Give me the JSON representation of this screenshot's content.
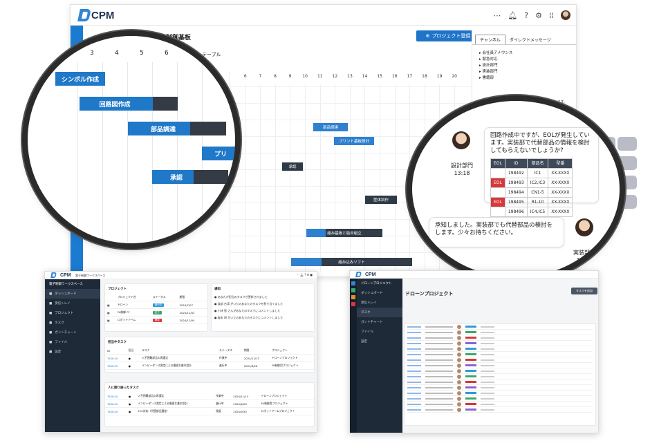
{
  "app": {
    "name": "CPM"
  },
  "main": {
    "gantt_title": "制御基板",
    "project_button": "プロジェクト登録",
    "table_label": "テーブル",
    "days": [
      "6",
      "7",
      "8",
      "9",
      "10",
      "11",
      "12",
      "13",
      "14",
      "15",
      "16",
      "17",
      "18",
      "19",
      "20"
    ],
    "bars": [
      {
        "label": "部品調達"
      },
      {
        "label": "プリント基板設計"
      },
      {
        "label": "承認"
      },
      {
        "label": "基板製造"
      },
      {
        "label": "基板試作"
      },
      {
        "label": "筐体試作"
      },
      {
        "label": "生産移"
      },
      {
        "label": "組み基板と結合組立"
      },
      {
        "label": "組み込みソフト"
      }
    ]
  },
  "right_panel": {
    "tabs": [
      "チャンネル",
      "ダイレクトメッセージ"
    ],
    "channels": [
      "会社員アナウンス",
      "緊急対応",
      "設計部門",
      "実装部門",
      "書籍部"
    ],
    "snippet": "回路作成中ですが、EOLが発生しています。実装部で代替部品の情報を検討"
  },
  "lens_gantt": {
    "day_nums": [
      "2",
      "3",
      "4",
      "5",
      "6",
      "7"
    ],
    "bars": [
      {
        "label": "シンボル作成"
      },
      {
        "label": "回路図作成"
      },
      {
        "label": "部品調達"
      },
      {
        "label": "プリ"
      },
      {
        "label": "承認"
      }
    ]
  },
  "lens_chat": {
    "msg1": "回路作成中ですが、EOLが発生しています。実装部で代替部品の情報を検討してもらえないでしょうか?",
    "sender1": "設計部門",
    "time1": "13:18",
    "table_headers": [
      "EOL",
      "ID",
      "部品名",
      "型番"
    ],
    "table_rows": [
      {
        "eol": "",
        "id": "198492",
        "part": "IC1",
        "model": "XX-XXXX"
      },
      {
        "eol": "EOL",
        "id": "198493",
        "part": "IC2,IC3",
        "model": "XX-XXXX"
      },
      {
        "eol": "",
        "id": "198494",
        "part": "CN1-5",
        "model": "XX-XXXX"
      },
      {
        "eol": "EOL",
        "id": "198495",
        "part": "R1-10",
        "model": "XX-XXXX"
      },
      {
        "eol": "",
        "id": "198496",
        "part": "IC4,IC5",
        "model": "XX-XXXX"
      }
    ],
    "msg2": "承知しました。実装部でも代替部品の検討をします。少々お待ちください。",
    "sender2": "実装部門",
    "time2": "13:19"
  },
  "dash": {
    "workspace": "電子制御ワークスペース",
    "sidebar": [
      "ダッシュボード",
      "受信トレイ",
      "プロジェクト",
      "タスク",
      "ガントチャート",
      "ファイル",
      "設定"
    ],
    "projects_title": "プロジェクト",
    "projects_headers": [
      "プロジェクト名",
      "ステータス",
      "期限"
    ],
    "projects": [
      {
        "name": "ドローン",
        "status": "進行中",
        "date": "2024/7/07",
        "color": "#2f9bd6"
      },
      {
        "name": "FA制御 PF",
        "status": "完了",
        "date": "2024/11/02",
        "color": "#3aa86b"
      },
      {
        "name": "ロボットアーム",
        "status": "遅延",
        "date": "2024/11/04",
        "color": "#d6383b"
      }
    ],
    "notices_title": "通知",
    "notices": [
      "あなたが担当のタスクが更新されました",
      "渡部 台湾 がいたのあなたのタスクを割り当てました",
      "小林 智 さんがあなたのタスクにコメントしました",
      "森本 四 がいたのあなたのタスクにコメントしました"
    ],
    "tasks_title": "担当中タスク",
    "tasks_headers": [
      "ID",
      "担当",
      "タスク",
      "ステータス",
      "期限",
      "プロジェクト"
    ],
    "tasks": [
      {
        "id": "TASK-00",
        "task": "入手困難部品の再選定",
        "status": "作業中",
        "date": "2024/11/13",
        "proj": "ドローンプロジェクト"
      },
      {
        "id": "TASK-00",
        "task": "インピーダンス測定による最適な基本設計",
        "status": "進行中",
        "date": "2024/6/26",
        "proj": "FA制御用プロジェクト"
      }
    ],
    "assigned_title": "人に割り振ったタスク",
    "assigned": [
      {
        "id": "TASK-00",
        "task": "入手困難部品の再選定",
        "status": "作業中",
        "date": "2024/11/13",
        "proj": "ドローンプロジェクト"
      },
      {
        "id": "TASK-00",
        "task": "インピーダンス測定による最適な基本設計",
        "status": "進行中",
        "date": "2024/6/26",
        "proj": "FA制御用プロジェクト"
      },
      {
        "id": "TASK-00",
        "task": "EOL対応（代替部品選定）",
        "status": "保留",
        "date": "2024/9/30",
        "proj": "ロボットアームプロジェクト"
      }
    ]
  },
  "taskwin": {
    "title": "ドローンプロジェクト",
    "add_button": "タスクを追加",
    "sidebar": [
      "ダッシュボード",
      "受信トレイ",
      "タスク",
      "ガントチャート",
      "ファイル",
      "設定"
    ]
  }
}
